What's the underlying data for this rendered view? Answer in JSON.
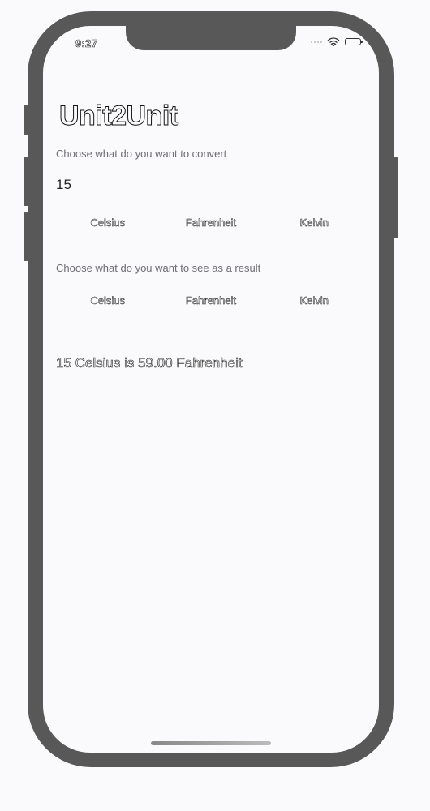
{
  "status_bar": {
    "time": "9:27"
  },
  "app": {
    "title": "Unit2Unit"
  },
  "input_section": {
    "prompt": "Choose what do you want to convert",
    "amount": "15",
    "units": [
      "Celsius",
      "Fahrenheit",
      "Kelvin"
    ],
    "selected_unit": "Celsius"
  },
  "output_section": {
    "prompt": "Choose what do you want to see as a result",
    "units": [
      "Celsius",
      "Fahrenheit",
      "Kelvin"
    ],
    "selected_unit": "Fahrenheit"
  },
  "result": {
    "text": "15 Celsius is 59.00 Fahrenheit"
  },
  "icons": [
    "wifi-icon",
    "battery-icon",
    "cellular-signal-icon"
  ],
  "colors": {
    "device_frame": "#585858",
    "screen_background": "#fafafc",
    "secondary_text": "#6e6e73"
  }
}
